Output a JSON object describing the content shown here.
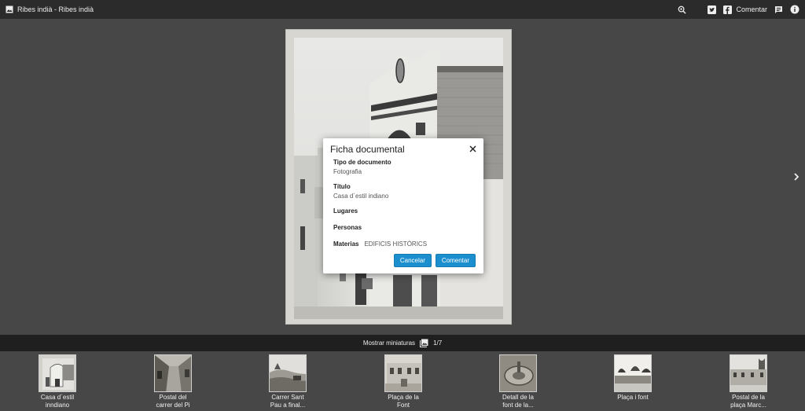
{
  "header": {
    "title": "Ribes indià - Ribes indià",
    "comment_label": "Comentar",
    "icons": [
      "image-icon",
      "zoom-icon",
      "twitter-icon",
      "facebook-icon",
      "comment-icon",
      "info-icon"
    ]
  },
  "modal": {
    "title": "Ficha documental",
    "fields": {
      "tipo_label": "Tipo de documento",
      "tipo_value": "Fotografia",
      "titulo_label": "Título",
      "titulo_value": "Casa d´estil indiano",
      "lugares_label": "Lugares",
      "personas_label": "Personas",
      "materias_label": "Materias",
      "materias_value": "EDIFICIS HISTÒRICS"
    },
    "cancel_label": "Cancelar",
    "submit_label": "Comentar"
  },
  "thumbnails_bar": {
    "toggle_label": "Mostrar miniaturas",
    "page_counter": "1/7"
  },
  "thumbnails": [
    {
      "label": "Casa d´estil\ninndiano"
    },
    {
      "label": "Postal del\ncarrer del Pi"
    },
    {
      "label": "Carrer Sant\nPau a final..."
    },
    {
      "label": "Plaça de la\nFont"
    },
    {
      "label": "Detall de la\nfont de la..."
    },
    {
      "label": "Plaça i font"
    },
    {
      "label": "Postal de la\nplaça Marc..."
    }
  ],
  "colors": {
    "accent": "#1b8fce",
    "topbar": "#2b2b2b",
    "background": "#474747",
    "strip_header": "#1f1f1f"
  }
}
